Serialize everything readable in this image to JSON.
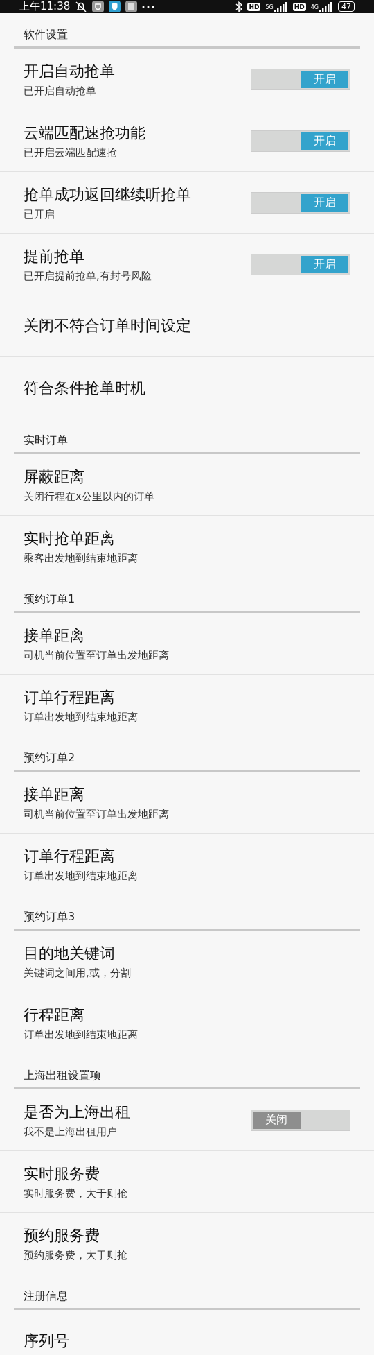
{
  "status_bar": {
    "time": "上午11:38",
    "hd_1": "HD",
    "network_1": "5G",
    "hd_2": "HD",
    "network_2": "4G",
    "battery": "47"
  },
  "sections": [
    {
      "title": "软件设置",
      "items": [
        {
          "title": "开启自动抢单",
          "subtitle": "已开启自动抢单",
          "toggle": {
            "on": true,
            "label": "开启"
          }
        },
        {
          "title": "云端匹配速抢功能",
          "subtitle": "已开启云端匹配速抢",
          "toggle": {
            "on": true,
            "label": "开启"
          }
        },
        {
          "title": "抢单成功返回继续听抢单",
          "subtitle": "已开启",
          "toggle": {
            "on": true,
            "label": "开启"
          }
        },
        {
          "title": "提前抢单",
          "subtitle": "已开启提前抢单,有封号风险",
          "toggle": {
            "on": true,
            "label": "开启"
          }
        },
        {
          "title": "关闭不符合订单时间设定"
        },
        {
          "title": "符合条件抢单时机"
        }
      ]
    },
    {
      "title": "实时订单",
      "items": [
        {
          "title": "屏蔽距离",
          "subtitle": "关闭行程在x公里以内的订单"
        },
        {
          "title": "实时抢单距离",
          "subtitle": "乘客出发地到结束地距离"
        }
      ]
    },
    {
      "title": "预约订单1",
      "items": [
        {
          "title": "接单距离",
          "subtitle": "司机当前位置至订单出发地距离"
        },
        {
          "title": "订单行程距离",
          "subtitle": "订单出发地到结束地距离"
        }
      ]
    },
    {
      "title": "预约订单2",
      "items": [
        {
          "title": "接单距离",
          "subtitle": "司机当前位置至订单出发地距离"
        },
        {
          "title": "订单行程距离",
          "subtitle": "订单出发地到结束地距离"
        }
      ]
    },
    {
      "title": "预约订单3",
      "items": [
        {
          "title": "目的地关键词",
          "subtitle": "关键词之间用,或，分割"
        },
        {
          "title": "行程距离",
          "subtitle": "订单出发地到结束地距离"
        }
      ]
    },
    {
      "title": "上海出租设置项",
      "items": [
        {
          "title": "是否为上海出租",
          "subtitle": "我不是上海出租用户",
          "toggle": {
            "on": false,
            "label": "关闭"
          }
        },
        {
          "title": "实时服务费",
          "subtitle": "实时服务费，大于则抢"
        },
        {
          "title": "预约服务费",
          "subtitle": "预约服务费，大于则抢"
        }
      ]
    },
    {
      "title": "注册信息",
      "items": [
        {
          "title": "序列号"
        }
      ]
    }
  ]
}
